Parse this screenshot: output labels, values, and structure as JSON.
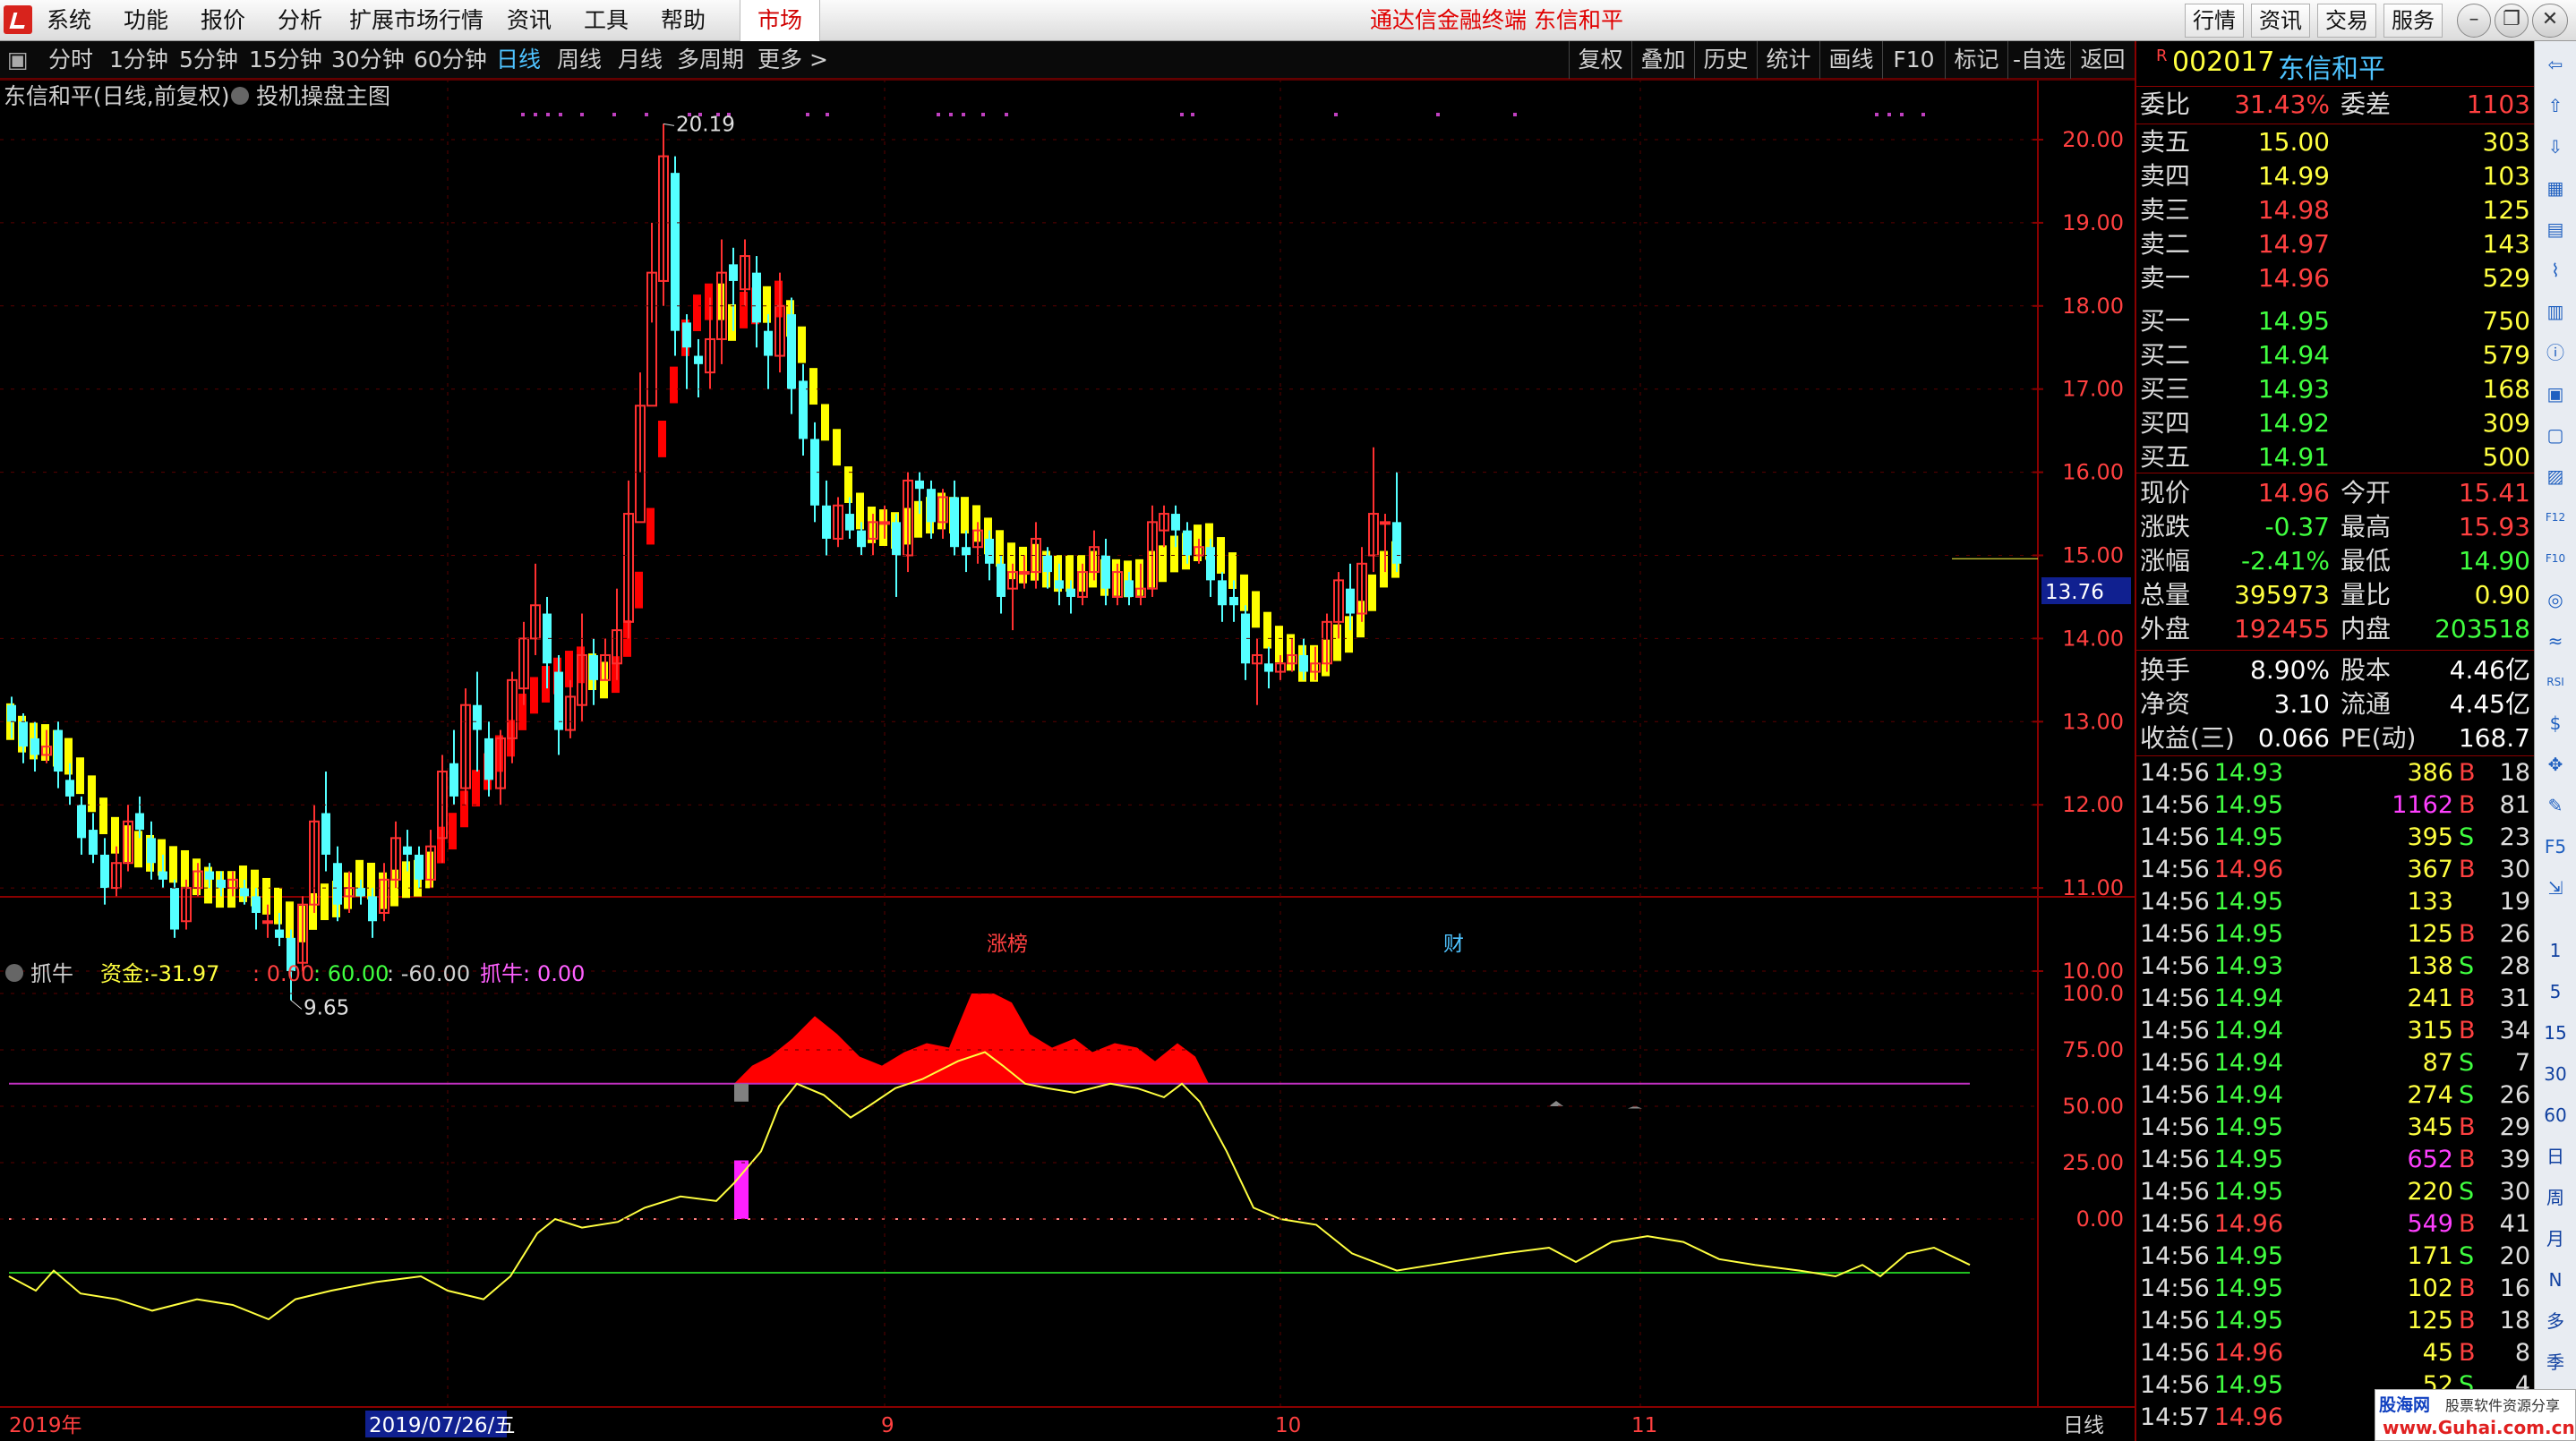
{
  "menubar": {
    "items": [
      "系统",
      "功能",
      "报价",
      "分析",
      "扩展市场行情",
      "资讯",
      "工具",
      "帮助"
    ],
    "market": "市场",
    "title": "通达信金融终端  东信和平",
    "buttons": [
      "行情",
      "资讯",
      "交易",
      "服务"
    ]
  },
  "periods": {
    "items": [
      "分时",
      "1分钟",
      "5分钟",
      "15分钟",
      "30分钟",
      "60分钟",
      "日线",
      "周线",
      "月线",
      "多周期",
      "更多 >"
    ],
    "active": "日线"
  },
  "tools": [
    "复权",
    "叠加",
    "历史",
    "统计",
    "画线",
    "F10",
    "标记",
    "-自选",
    "返回"
  ],
  "chart": {
    "title": "东信和平(日线,前复权)",
    "template": "投机操盘主图",
    "yticks": [
      "20.00",
      "19.00",
      "18.00",
      "17.00",
      "16.00",
      "15.00",
      "14.00",
      "13.00",
      "12.00",
      "11.00",
      "10.00"
    ],
    "high_label": "20.19",
    "low_label": "9.65",
    "price_tag": "13.76",
    "marker_zhangbang": "涨榜",
    "marker_cai": "财",
    "ind_name": "抓牛",
    "ind_fund_label": "资金:",
    "ind_fund_val": "-31.97",
    "ind_a": ": 0.00",
    "ind_b": ": 60.00",
    "ind_c": ": -60.00",
    "ind_d_label": "抓牛:",
    "ind_d_val": "0.00",
    "ind_yticks": [
      "100.0",
      "75.00",
      "50.00",
      "25.00",
      "0.00"
    ],
    "dates": [
      "2019年",
      "2019/07/26/五",
      "9",
      "10",
      "11"
    ],
    "period_label": "日线",
    "colors": {
      "up": "#ff3030",
      "down": "#54ffff",
      "band_up": "#ff0000",
      "band_flat": "#ffff00",
      "ma": "#ffff40",
      "hline_purple": "#c030c0",
      "hline_green": "#20c020"
    }
  },
  "chart_data": {
    "type": "candlestick",
    "title": "东信和平(日线,前复权)",
    "ylim": [
      9.5,
      20.5
    ],
    "candles": [
      [
        13.2,
        13.0,
        13.3,
        12.8
      ],
      [
        13.0,
        12.7,
        13.1,
        12.5
      ],
      [
        12.8,
        12.6,
        13.0,
        12.4
      ],
      [
        12.6,
        12.7,
        12.9,
        12.5
      ],
      [
        12.9,
        12.4,
        13.0,
        12.2
      ],
      [
        12.3,
        12.1,
        12.5,
        12.0
      ],
      [
        12.0,
        11.6,
        12.1,
        11.4
      ],
      [
        11.7,
        11.4,
        11.9,
        11.3
      ],
      [
        11.4,
        11.0,
        11.6,
        10.8
      ],
      [
        11.0,
        11.3,
        11.5,
        10.9
      ],
      [
        11.3,
        11.8,
        12.0,
        11.2
      ],
      [
        11.9,
        11.7,
        12.1,
        11.6
      ],
      [
        11.6,
        11.3,
        11.8,
        11.1
      ],
      [
        11.2,
        11.1,
        11.4,
        11.0
      ],
      [
        11.0,
        10.5,
        11.1,
        10.4
      ],
      [
        10.6,
        11.0,
        11.1,
        10.5
      ],
      [
        11.0,
        11.2,
        11.3,
        10.9
      ],
      [
        11.2,
        11.1,
        11.3,
        11.0
      ],
      [
        11.1,
        11.0,
        11.2,
        10.9
      ],
      [
        11.0,
        11.1,
        11.2,
        10.9
      ],
      [
        11.0,
        10.9,
        11.1,
        10.8
      ],
      [
        10.9,
        10.7,
        11.0,
        10.5
      ],
      [
        10.6,
        10.6,
        10.8,
        10.4
      ],
      [
        10.5,
        10.4,
        10.7,
        10.3
      ],
      [
        10.4,
        10.0,
        10.5,
        9.65
      ],
      [
        10.1,
        10.8,
        10.9,
        10.0
      ],
      [
        10.8,
        11.8,
        12.0,
        10.7
      ],
      [
        11.9,
        11.4,
        12.4,
        11.2
      ],
      [
        11.3,
        10.8,
        11.5,
        10.6
      ],
      [
        10.9,
        11.0,
        11.2,
        10.7
      ],
      [
        11.0,
        10.9,
        11.1,
        10.8
      ],
      [
        10.9,
        10.6,
        11.0,
        10.4
      ],
      [
        10.7,
        11.1,
        11.3,
        10.6
      ],
      [
        11.1,
        11.6,
        11.8,
        11.0
      ],
      [
        11.5,
        11.4,
        11.7,
        11.2
      ],
      [
        11.4,
        11.1,
        11.5,
        11.0
      ],
      [
        11.1,
        11.5,
        11.7,
        11.0
      ],
      [
        11.6,
        12.4,
        12.6,
        11.3
      ],
      [
        12.5,
        12.1,
        12.9,
        12.0
      ],
      [
        12.2,
        13.2,
        13.4,
        12.0
      ],
      [
        13.2,
        12.9,
        13.6,
        12.4
      ],
      [
        12.8,
        12.3,
        13.0,
        12.1
      ],
      [
        12.2,
        12.8,
        12.9,
        12.0
      ],
      [
        12.8,
        13.5,
        13.6,
        12.5
      ],
      [
        13.4,
        14.0,
        14.2,
        13.2
      ],
      [
        14.0,
        14.4,
        14.9,
        13.8
      ],
      [
        14.3,
        13.7,
        14.5,
        13.4
      ],
      [
        13.6,
        12.9,
        13.8,
        12.6
      ],
      [
        12.9,
        13.3,
        13.5,
        12.8
      ],
      [
        13.2,
        13.8,
        14.3,
        13.0
      ],
      [
        13.8,
        13.5,
        14.0,
        13.2
      ],
      [
        13.5,
        13.8,
        14.0,
        13.5
      ],
      [
        13.7,
        14.1,
        14.6,
        13.5
      ],
      [
        14.2,
        15.5,
        15.9,
        14.0
      ],
      [
        15.4,
        16.8,
        17.2,
        16.0
      ],
      [
        16.8,
        18.4,
        19.0,
        17.8
      ],
      [
        18.3,
        19.8,
        20.19,
        18.0
      ],
      [
        19.6,
        17.7,
        19.8,
        17.4
      ],
      [
        17.8,
        17.5,
        17.9,
        17.0
      ],
      [
        17.4,
        17.3,
        17.6,
        16.9
      ],
      [
        17.2,
        17.6,
        18.1,
        17.0
      ],
      [
        17.6,
        18.4,
        18.8,
        17.3
      ],
      [
        18.5,
        18.3,
        18.7,
        17.7
      ],
      [
        18.2,
        18.6,
        18.8,
        18.0
      ],
      [
        18.4,
        17.8,
        18.6,
        17.5
      ],
      [
        17.7,
        17.4,
        17.9,
        17.0
      ],
      [
        17.4,
        18.0,
        18.4,
        17.2
      ],
      [
        17.9,
        17.0,
        18.1,
        16.7
      ],
      [
        17.1,
        16.4,
        17.3,
        16.2
      ],
      [
        16.4,
        15.6,
        16.6,
        15.4
      ],
      [
        15.6,
        15.2,
        15.9,
        15.0
      ],
      [
        15.2,
        15.6,
        15.7,
        15.1
      ],
      [
        15.5,
        15.3,
        15.7,
        15.2
      ],
      [
        15.3,
        15.1,
        15.4,
        15.0
      ],
      [
        15.2,
        15.4,
        15.5,
        15.0
      ],
      [
        15.4,
        15.4,
        15.6,
        15.2
      ],
      [
        15.4,
        15.0,
        15.5,
        14.5
      ],
      [
        15.0,
        15.9,
        16.0,
        14.8
      ],
      [
        15.9,
        15.8,
        16.0,
        15.5
      ],
      [
        15.8,
        15.4,
        15.9,
        15.2
      ],
      [
        15.4,
        15.7,
        15.8,
        15.2
      ],
      [
        15.7,
        15.1,
        15.9,
        15.0
      ],
      [
        15.1,
        15.0,
        15.3,
        14.8
      ],
      [
        15.1,
        15.3,
        15.4,
        14.9
      ],
      [
        15.2,
        14.9,
        15.3,
        14.7
      ],
      [
        14.9,
        14.5,
        15.0,
        14.3
      ],
      [
        14.6,
        14.8,
        14.9,
        14.1
      ],
      [
        14.8,
        14.8,
        15.0,
        14.6
      ],
      [
        14.8,
        15.2,
        15.4,
        14.6
      ],
      [
        15.0,
        14.8,
        15.1,
        14.6
      ],
      [
        14.7,
        14.6,
        14.9,
        14.4
      ],
      [
        14.6,
        14.5,
        14.7,
        14.3
      ],
      [
        14.5,
        14.8,
        14.9,
        14.4
      ],
      [
        14.8,
        15.1,
        15.3,
        14.7
      ],
      [
        15.0,
        14.6,
        15.2,
        14.4
      ],
      [
        14.5,
        14.8,
        14.9,
        14.4
      ],
      [
        14.7,
        14.5,
        14.8,
        14.4
      ],
      [
        14.5,
        14.6,
        14.9,
        14.4
      ],
      [
        14.6,
        15.4,
        15.6,
        14.5
      ],
      [
        15.3,
        15.5,
        15.6,
        15.1
      ],
      [
        15.5,
        15.3,
        15.6,
        15.1
      ],
      [
        15.3,
        15.0,
        15.4,
        14.9
      ],
      [
        15.0,
        15.1,
        15.2,
        14.9
      ],
      [
        15.1,
        14.7,
        15.2,
        14.5
      ],
      [
        14.7,
        14.4,
        14.8,
        14.2
      ],
      [
        14.5,
        14.4,
        14.7,
        14.2
      ],
      [
        14.3,
        13.7,
        14.4,
        13.5
      ],
      [
        13.7,
        13.8,
        14.0,
        13.2
      ],
      [
        13.7,
        13.6,
        13.9,
        13.4
      ],
      [
        13.6,
        13.7,
        13.8,
        13.5
      ],
      [
        13.7,
        13.8,
        14.0,
        13.6
      ],
      [
        13.8,
        13.6,
        14.0,
        13.5
      ],
      [
        13.6,
        13.7,
        13.9,
        13.5
      ],
      [
        13.7,
        14.2,
        14.3,
        13.6
      ],
      [
        14.2,
        14.7,
        14.8,
        14.0
      ],
      [
        14.6,
        14.3,
        14.9,
        14.1
      ],
      [
        14.3,
        14.9,
        15.1,
        14.2
      ],
      [
        15.0,
        15.5,
        16.3,
        14.8
      ],
      [
        15.4,
        15.4,
        15.5,
        14.8
      ],
      [
        15.4,
        14.9,
        16.0,
        14.8
      ]
    ],
    "x_ticks": [
      "2019年",
      "2019/07/26/五",
      "9",
      "10",
      "11"
    ]
  },
  "quote": {
    "code": "002017",
    "name": "东信和平",
    "flag": "R",
    "weibi_label": "委比",
    "weibi": "31.43%",
    "weicha_label": "委差",
    "weicha": "1103",
    "asks": [
      {
        "l": "卖五",
        "p": "15.00",
        "v": "303"
      },
      {
        "l": "卖四",
        "p": "14.99",
        "v": "103"
      },
      {
        "l": "卖三",
        "p": "14.98",
        "v": "125"
      },
      {
        "l": "卖二",
        "p": "14.97",
        "v": "143"
      },
      {
        "l": "卖一",
        "p": "14.96",
        "v": "529"
      }
    ],
    "bids": [
      {
        "l": "买一",
        "p": "14.95",
        "v": "750"
      },
      {
        "l": "买二",
        "p": "14.94",
        "v": "579"
      },
      {
        "l": "买三",
        "p": "14.93",
        "v": "168"
      },
      {
        "l": "买四",
        "p": "14.92",
        "v": "309"
      },
      {
        "l": "买五",
        "p": "14.91",
        "v": "500"
      }
    ],
    "stats": [
      {
        "l1": "现价",
        "v1": "14.96",
        "c1": "#ff4040",
        "l2": "今开",
        "v2": "15.41",
        "c2": "#ff4040"
      },
      {
        "l1": "涨跌",
        "v1": "-0.37",
        "c1": "#40ff40",
        "l2": "最高",
        "v2": "15.93",
        "c2": "#ff4040"
      },
      {
        "l1": "涨幅",
        "v1": "-2.41%",
        "c1": "#40ff40",
        "l2": "最低",
        "v2": "14.90",
        "c2": "#40ff40"
      },
      {
        "l1": "总量",
        "v1": "395973",
        "c1": "#ffff40",
        "l2": "量比",
        "v2": "0.90",
        "c2": "#ffff40"
      },
      {
        "l1": "外盘",
        "v1": "192455",
        "c1": "#ff4040",
        "l2": "内盘",
        "v2": "203518",
        "c2": "#40ff40"
      }
    ],
    "fin": [
      {
        "l1": "换手",
        "v1": "8.90%",
        "l2": "股本",
        "v2": "4.46亿"
      },
      {
        "l1": "净资",
        "v1": "3.10",
        "l2": "流通",
        "v2": "4.45亿"
      },
      {
        "l1": "收益(三)",
        "v1": "0.066",
        "l2": "PE(动)",
        "v2": "168.7"
      }
    ],
    "ticks": [
      [
        "14:56",
        "14.93",
        "386",
        "B",
        "18"
      ],
      [
        "14:56",
        "14.95",
        "1162",
        "B",
        "81"
      ],
      [
        "14:56",
        "14.95",
        "395",
        "S",
        "23"
      ],
      [
        "14:56",
        "14.96",
        "367",
        "B",
        "30"
      ],
      [
        "14:56",
        "14.95",
        "133",
        "",
        "19"
      ],
      [
        "14:56",
        "14.95",
        "125",
        "B",
        "26"
      ],
      [
        "14:56",
        "14.93",
        "138",
        "S",
        "28"
      ],
      [
        "14:56",
        "14.94",
        "241",
        "B",
        "31"
      ],
      [
        "14:56",
        "14.94",
        "315",
        "B",
        "34"
      ],
      [
        "14:56",
        "14.94",
        "87",
        "S",
        "7"
      ],
      [
        "14:56",
        "14.94",
        "274",
        "S",
        "26"
      ],
      [
        "14:56",
        "14.95",
        "345",
        "B",
        "29"
      ],
      [
        "14:56",
        "14.95",
        "652",
        "B",
        "39"
      ],
      [
        "14:56",
        "14.95",
        "220",
        "S",
        "30"
      ],
      [
        "14:56",
        "14.96",
        "549",
        "B",
        "41"
      ],
      [
        "14:56",
        "14.95",
        "171",
        "S",
        "20"
      ],
      [
        "14:56",
        "14.95",
        "102",
        "B",
        "16"
      ],
      [
        "14:56",
        "14.95",
        "125",
        "B",
        "18"
      ],
      [
        "14:56",
        "14.96",
        "45",
        "B",
        "8"
      ],
      [
        "14:56",
        "14.95",
        "52",
        "S",
        "4"
      ],
      [
        "14:57",
        "14.96",
        "",
        "",
        ""
      ]
    ]
  },
  "rightbar": [
    "1",
    "5",
    "15",
    "30",
    "60",
    "日",
    "周",
    "月",
    "N",
    "多",
    "季"
  ],
  "watermark": {
    "line1": "股海网",
    "line2": "股票软件资源分享",
    "url": "www.Guhai.com.cn"
  }
}
